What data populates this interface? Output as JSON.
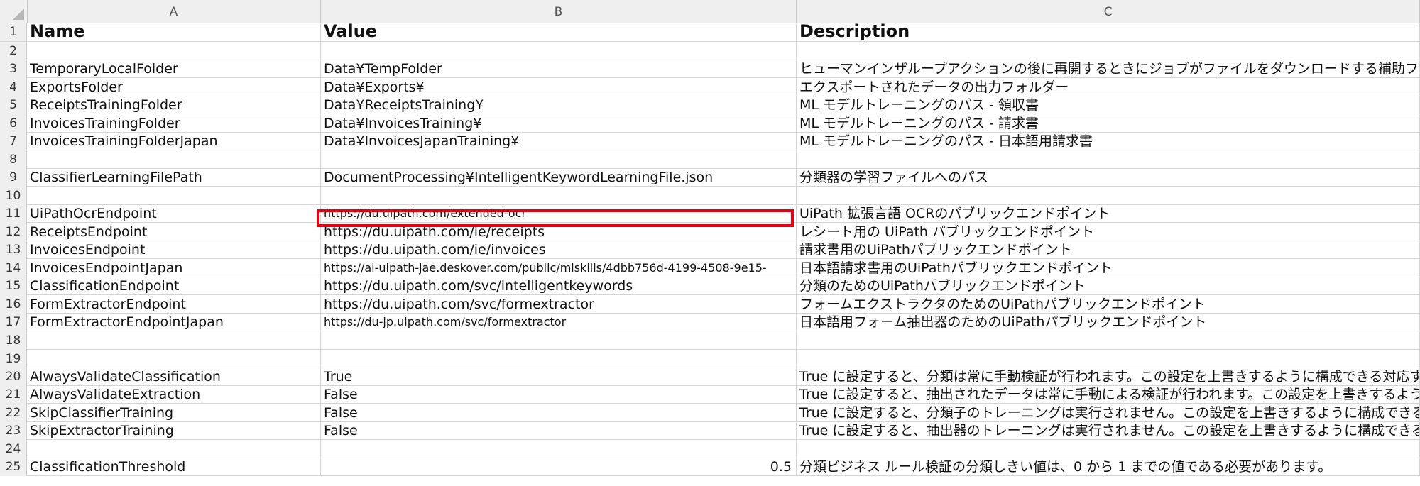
{
  "columns": [
    "A",
    "B",
    "C"
  ],
  "rows": [
    {
      "num": "1",
      "a": "Name",
      "b": "Value",
      "c": "Description"
    },
    {
      "num": "2",
      "a": "",
      "b": "",
      "c": ""
    },
    {
      "num": "3",
      "a": "TemporaryLocalFolder",
      "b": "Data¥TempFolder",
      "c": "ヒューマンインザループアクションの後に再開するときにジョブがファイルをダウンロードする補助フォルダー。ファイルの保"
    },
    {
      "num": "4",
      "a": "ExportsFolder",
      "b": "Data¥Exports¥",
      "c": "エクスポートされたデータの出力フォルダー"
    },
    {
      "num": "5",
      "a": "ReceiptsTrainingFolder",
      "b": "Data¥ReceiptsTraining¥",
      "c": "ML モデルトレーニングのパス - 領収書"
    },
    {
      "num": "6",
      "a": "InvoicesTrainingFolder",
      "b": "Data¥InvoicesTraining¥",
      "c": "ML モデルトレーニングのパス - 請求書"
    },
    {
      "num": "7",
      "a": "InvoicesTrainingFolderJapan",
      "b": "Data¥InvoicesJapanTraining¥",
      "c": "ML モデルトレーニングのパス - 日本語用請求書"
    },
    {
      "num": "8",
      "a": "",
      "b": "",
      "c": ""
    },
    {
      "num": "9",
      "a": "ClassifierLearningFilePath",
      "b": "DocumentProcessing¥IntelligentKeywordLearningFile.json",
      "c": "分類器の学習ファイルへのパス"
    },
    {
      "num": "10",
      "a": "",
      "b": "",
      "c": ""
    },
    {
      "num": "11",
      "a": "UiPathOcrEndpoint",
      "b": "https://du.uipath.com/extended-ocr",
      "c": "UiPath 拡張言語 OCRのパブリックエンドポイント",
      "small": true
    },
    {
      "num": "12",
      "a": "ReceiptsEndpoint",
      "b": "https://du.uipath.com/ie/receipts",
      "c": "レシート用の UiPath パブリックエンドポイント"
    },
    {
      "num": "13",
      "a": "InvoicesEndpoint",
      "b": "https://du.uipath.com/ie/invoices",
      "c": "請求書用のUiPathパブリックエンドポイント"
    },
    {
      "num": "14",
      "a": "InvoicesEndpointJapan",
      "b": "https://ai-uipath-jae.deskover.com/public/mlskills/4dbb756d-4199-4508-9e15-",
      "c": "日本語請求書用のUiPathパブリックエンドポイント",
      "small": true
    },
    {
      "num": "15",
      "a": "ClassificationEndpoint",
      "b": "https://du.uipath.com/svc/intelligentkeywords",
      "c": "分類のためのUiPathパブリックエンドポイント"
    },
    {
      "num": "16",
      "a": "FormExtractorEndpoint",
      "b": "https://du.uipath.com/svc/formextractor",
      "c": "フォームエクストラクタのためのUiPathパブリックエンドポイント"
    },
    {
      "num": "17",
      "a": "FormExtractorEndpointJapan",
      "b": "https://du-jp.uipath.com/svc/formextractor",
      "c": "日本語用フォーム抽出器のためのUiPathパブリックエンドポイント",
      "small": true
    },
    {
      "num": "18",
      "a": "",
      "b": "",
      "c": ""
    },
    {
      "num": "19",
      "a": "",
      "b": "",
      "c": ""
    },
    {
      "num": "20",
      "a": "AlwaysValidateClassification",
      "b": "True",
      "c": "True に設定すると、分類は常に手動検証が行われます。この設定を上書きするように構成できる対応するアセ"
    },
    {
      "num": "21",
      "a": "AlwaysValidateExtraction",
      "b": "False",
      "c": "True に設定すると、抽出されたデータは常に手動による検証が行われます。この設定を上書きするように構成で"
    },
    {
      "num": "22",
      "a": "SkipClassifierTraining",
      "b": "False",
      "c": "True に設定すると、分類子のトレーニングは実行されません。この設定を上書きするように構成できる対応する"
    },
    {
      "num": "23",
      "a": "SkipExtractorTraining",
      "b": "False",
      "c": "True に設定すると、抽出器のトレーニングは実行されません。この設定を上書きするように構成できる対応する"
    },
    {
      "num": "24",
      "a": "",
      "b": "",
      "c": ""
    },
    {
      "num": "25",
      "a": "ClassificationThreshold",
      "b": "0.5",
      "c": "分類ビジネス ルール検証の分類しきい値は、0 から 1 までの値である必要があります。",
      "numeric": true
    }
  ]
}
